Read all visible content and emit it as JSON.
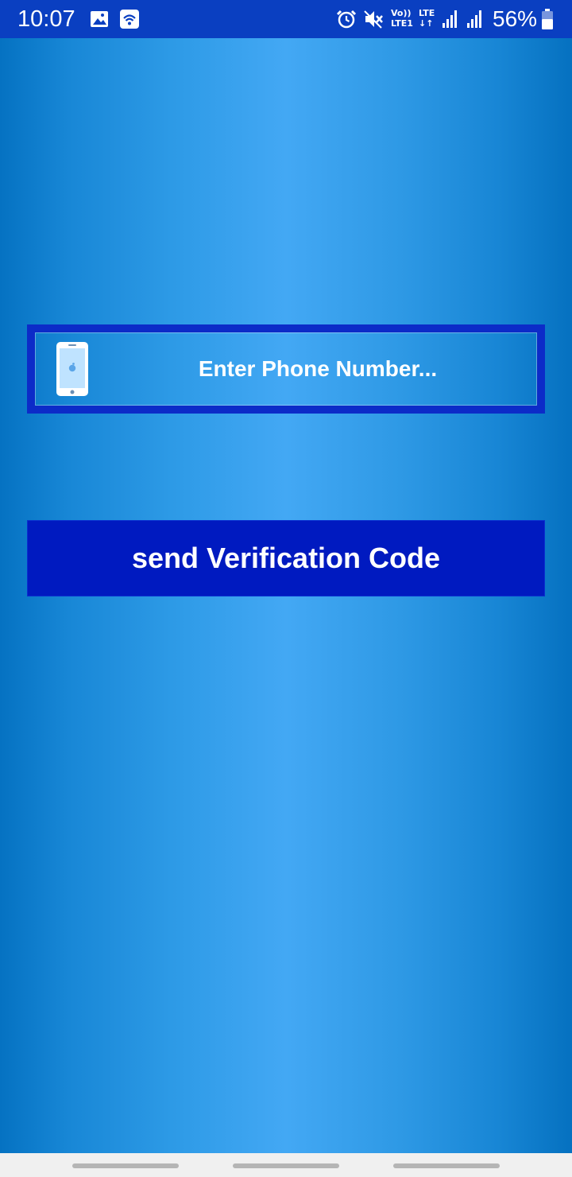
{
  "status_bar": {
    "time": "10:07",
    "battery_percent": "56%",
    "volte_line1": "Vo))",
    "volte_line2": "LTE1",
    "lte_line1": "LTE",
    "lte_line2": "↓↑",
    "icons": [
      "image-icon",
      "wifi-icon",
      "alarm-icon",
      "mute-icon",
      "volte-icon",
      "lte-icon",
      "signal-icon",
      "signal-icon",
      "battery-icon"
    ]
  },
  "form": {
    "phone_placeholder": "Enter Phone Number...",
    "phone_icon": "phone-icon",
    "send_button_label": "send Verification Code"
  },
  "colors": {
    "status_bar": "#0a3fc1",
    "field_border": "#0c2bc8",
    "button": "#001ac0",
    "background_center": "#43a8f4",
    "background_edge": "#0572c2",
    "nav_bar": "#f0f0f0"
  }
}
